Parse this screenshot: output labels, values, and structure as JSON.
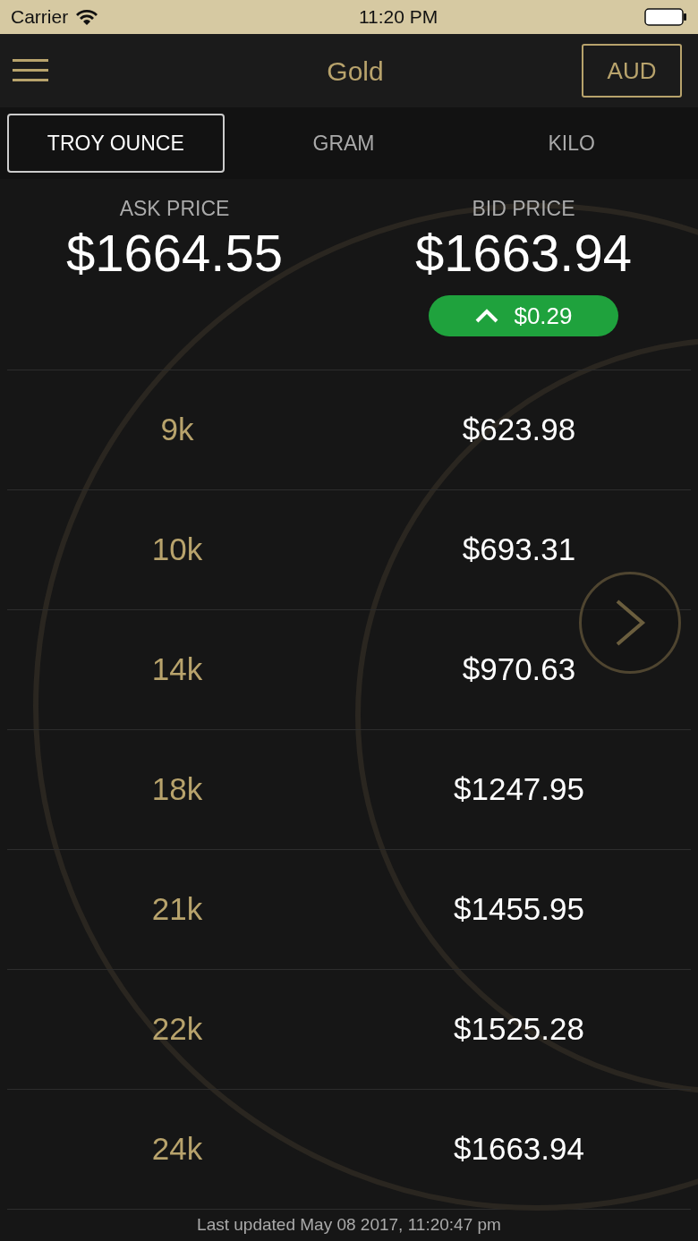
{
  "status_bar": {
    "carrier": "Carrier",
    "time": "11:20 PM"
  },
  "nav": {
    "title": "Gold",
    "currency": "AUD"
  },
  "tabs": [
    {
      "label": "TROY OUNCE",
      "selected": true
    },
    {
      "label": "GRAM",
      "selected": false
    },
    {
      "label": "KILO",
      "selected": false
    }
  ],
  "prices": {
    "ask_label": "ASK PRICE",
    "ask": "$1664.55",
    "bid_label": "BID PRICE",
    "bid": "$1663.94",
    "change": "$0.29",
    "rising": true
  },
  "purities": [
    {
      "karat": "9k",
      "price": "$623.98"
    },
    {
      "karat": "10k",
      "price": "$693.31"
    },
    {
      "karat": "14k",
      "price": "$970.63"
    },
    {
      "karat": "18k",
      "price": "$1247.95"
    },
    {
      "karat": "21k",
      "price": "$1455.95"
    },
    {
      "karat": "22k",
      "price": "$1525.28"
    },
    {
      "karat": "24k",
      "price": "$1663.94"
    }
  ],
  "footer": "Last updated May 08 2017, 11:20:47 pm"
}
